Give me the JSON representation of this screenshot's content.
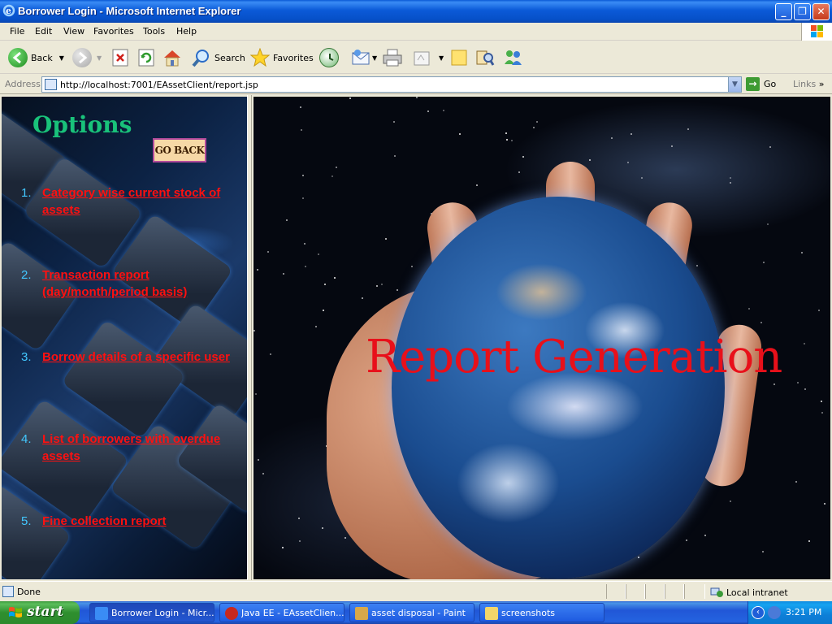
{
  "window": {
    "title": "Borrower Login - Microsoft Internet Explorer",
    "minimize": "_",
    "maximize": "❐",
    "close": "✕"
  },
  "menu": [
    "File",
    "Edit",
    "View",
    "Favorites",
    "Tools",
    "Help"
  ],
  "toolbar": {
    "back": "Back",
    "search": "Search",
    "favorites": "Favorites"
  },
  "address": {
    "label": "Address",
    "url": "http://localhost:7001/EAssetClient/report.jsp",
    "go": "Go",
    "links": "Links"
  },
  "left_frame": {
    "title": "Options",
    "go_back": "GO BACK",
    "options": [
      {
        "num": "1.",
        "label": "Category wise current stock of assets"
      },
      {
        "num": "2.",
        "label": "Transaction report (day/month/period basis)"
      },
      {
        "num": "3.",
        "label": "Borrow details of a specific user"
      },
      {
        "num": "4.",
        "label": "List of borrowers with overdue assets"
      },
      {
        "num": "5.",
        "label": "Fine collection report"
      }
    ]
  },
  "right_frame": {
    "heading": "Report Generation"
  },
  "status": {
    "text": "Done",
    "zone": "Local intranet"
  },
  "taskbar": {
    "start": "start",
    "tasks": [
      {
        "label": "Borrower Login - Micr...",
        "icon": "ie-icon"
      },
      {
        "label": "Java EE - EAssetClien...",
        "icon": "eclipse-icon"
      },
      {
        "label": "asset disposal - Paint",
        "icon": "paint-icon"
      },
      {
        "label": "screenshots",
        "icon": "folder-icon"
      }
    ],
    "clock": "3:21 PM"
  },
  "colors": {
    "option_link": "#ff1010",
    "option_number": "#42c8ff",
    "options_title": "#19c27a",
    "report_heading": "#e8101a"
  }
}
